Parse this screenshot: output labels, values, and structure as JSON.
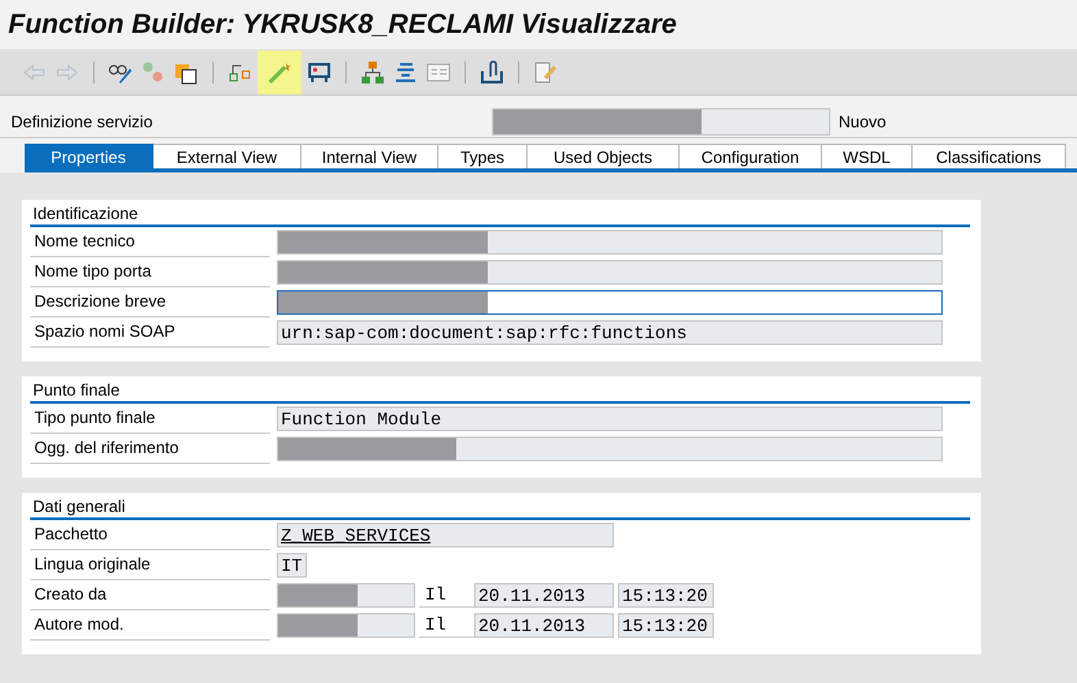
{
  "window": {
    "title": "Function Builder: YKRUSK8_RECLAMI Visualizzare"
  },
  "toolbar": {
    "groups": [
      [
        {
          "disabled": true,
          "selected": false
        },
        {
          "disabled": true,
          "selected": false
        }
      ],
      [
        {
          "disabled": false,
          "selected": false
        },
        {
          "disabled": false,
          "selected": false
        },
        {
          "disabled": false,
          "selected": false
        }
      ],
      [
        {
          "disabled": false,
          "selected": false
        },
        {
          "disabled": false,
          "selected": true
        },
        {
          "disabled": false,
          "selected": false
        }
      ],
      [
        {
          "disabled": false,
          "selected": false
        },
        {
          "disabled": false,
          "selected": false
        },
        {
          "disabled": false,
          "selected": false
        }
      ],
      [
        {
          "disabled": false,
          "selected": false
        }
      ],
      [
        {
          "disabled": false,
          "selected": false
        }
      ]
    ]
  },
  "header": {
    "label": "Definizione servizio",
    "field": {
      "redacted": true
    },
    "status": "Nuovo"
  },
  "tabs": [
    {
      "label": "Properties",
      "selected": true
    },
    {
      "label": "External View",
      "selected": false
    },
    {
      "label": "Internal View",
      "selected": false
    },
    {
      "label": "Types",
      "selected": false
    },
    {
      "label": "Used Objects",
      "selected": false
    },
    {
      "label": "Configuration",
      "selected": false
    },
    {
      "label": "WSDL",
      "selected": false
    },
    {
      "label": "Classifications",
      "selected": false
    }
  ],
  "sections": [
    {
      "title": "Identificazione",
      "rows": [
        {
          "kind": "line",
          "label": "Nome tecnico",
          "fields": [
            {
              "kind": "display",
              "redacted": true
            }
          ]
        },
        {
          "kind": "line",
          "label": "Nome tipo porta",
          "fields": [
            {
              "kind": "display",
              "redacted": true
            }
          ]
        },
        {
          "kind": "line",
          "label": "Descrizione breve",
          "fields": [
            {
              "kind": "input",
              "redacted": true
            }
          ]
        },
        {
          "kind": "line",
          "label": "Spazio nomi SOAP",
          "fields": [
            {
              "kind": "display",
              "value": "urn:sap-com:document:sap:rfc:functions"
            }
          ]
        }
      ]
    },
    {
      "title": "Punto finale",
      "rows": [
        {
          "kind": "line",
          "label": "Tipo punto finale",
          "fields": [
            {
              "kind": "display",
              "value": "Function Module"
            }
          ]
        },
        {
          "kind": "line",
          "label": "Ogg. del riferimento",
          "fields": [
            {
              "kind": "display",
              "redacted": true
            }
          ]
        }
      ]
    },
    {
      "title": "Dati generali",
      "rows": [
        {
          "kind": "package",
          "label": "Pacchetto",
          "fields": [
            {
              "kind": "link",
              "value": "Z_WEB_SERVICES"
            }
          ]
        },
        {
          "kind": "language",
          "label": "Lingua originale",
          "fields": [
            {
              "kind": "display",
              "value": "IT"
            }
          ]
        },
        {
          "kind": "author",
          "label": "Creato da",
          "fields": [
            {
              "kind": "display",
              "redacted": true
            },
            {
              "kind": "text",
              "value": "Il"
            },
            {
              "kind": "display",
              "value": "20.11.2013"
            },
            {
              "kind": "display",
              "value": "15:13:20"
            }
          ]
        },
        {
          "kind": "author",
          "label": "Autore mod.",
          "fields": [
            {
              "kind": "display",
              "redacted": true
            },
            {
              "kind": "text",
              "value": "Il"
            },
            {
              "kind": "display",
              "value": "20.11.2013"
            },
            {
              "kind": "display",
              "value": "15:13:20"
            }
          ]
        }
      ]
    }
  ]
}
